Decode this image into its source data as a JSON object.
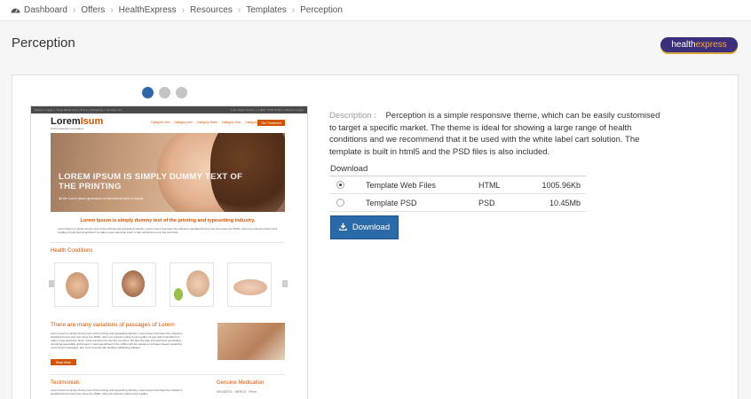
{
  "breadcrumb": {
    "items": [
      "Dashboard",
      "Offers",
      "HealthExpress",
      "Resources",
      "Templates",
      "Perception"
    ]
  },
  "page": {
    "title": "Perception",
    "brand_logo": {
      "part1": "health",
      "part2": "express"
    }
  },
  "carousel": {
    "slide_count": 3,
    "active_index": 0
  },
  "preview": {
    "topbar_left": "Patient Login  |  Free Wish List  |  Price  |  Shipping  |  Contact Us",
    "topbar_right": "Live Chat Online  |  1 800 7745 5734  |  Patient Login",
    "logo_main": "Lorem",
    "logo_accent": "Isum",
    "logo_sub": "Online Medical Consultation",
    "nav": [
      "Category one",
      "Category two",
      "Category three",
      "Category four",
      "Category five"
    ],
    "nav_button": "Get Treatment",
    "hero_title": "LOREM IPSUM IS SIMPLY DUMMY TEXT OF THE PRINTING",
    "hero_sub": "All the Lorem Ipsum generators on the Internet tend to repeat",
    "tagline": "Lorem Ipsum is simply dummy text of the printing and typesetting industry.",
    "tag_text": "Lorem Ipsum is simply dummy text of the printing and typesetting industry. Lorem Ipsum has been the industry's standard dummy text ever since the 1500s, when an unknown printer took a galley of type and scrambled it to make a type specimen book. It has survived not only five centuries.",
    "health_title": "Health Conditions",
    "section2_title": "There are many variations of passages of Lorem",
    "section2_text": "Lorem Ipsum is simply dummy text of the printing and typesetting industry. Lorem Ipsum has been the industry's standard dummy text ever since the 1500s, when an unknown printer took a galley of type and scrambled it to make a type specimen book. It has survived not only five centuries, but also the leap into electronic typesetting, remaining essentially unchanged. It was popularised in the 1960s with the release of Letraset sheets containing Lorem Ipsum passages, and more recently with desktop publishing software.",
    "read_more": "Read More",
    "testimonials_title": "Testimonials",
    "testimonials_text": "Lorem Ipsum is simply dummy text of the printing and typesetting industry. Lorem Ipsum has been the industry's standard dummy text ever since the 1500s, when an unknown printer took a galley.",
    "genuine_title": "Genuine Medication",
    "brand_logos": [
      "NOVARTIS",
      "MERCK",
      "Pfizer"
    ]
  },
  "description": {
    "label": "Description :",
    "text": "Perception is a simple responsive theme, which can be easily customised to target a specific market. The theme is ideal for showing a large range of health conditions and we recommend that it be used with the white label cart solution. The template is built in html5 and the PSD files is also included."
  },
  "download": {
    "title": "Download",
    "rows": [
      {
        "name": "Template Web Files",
        "type": "HTML",
        "size": "1005.96Kb",
        "selected": true
      },
      {
        "name": "Template PSD",
        "type": "PSD",
        "size": "10.45Mb",
        "selected": false
      }
    ],
    "button_label": "Download"
  },
  "colors": {
    "accent": "#2b6aa8",
    "preview_accent": "#d35400",
    "brand_bg": "#3b2f7b",
    "brand_orange": "#f3a93a"
  }
}
